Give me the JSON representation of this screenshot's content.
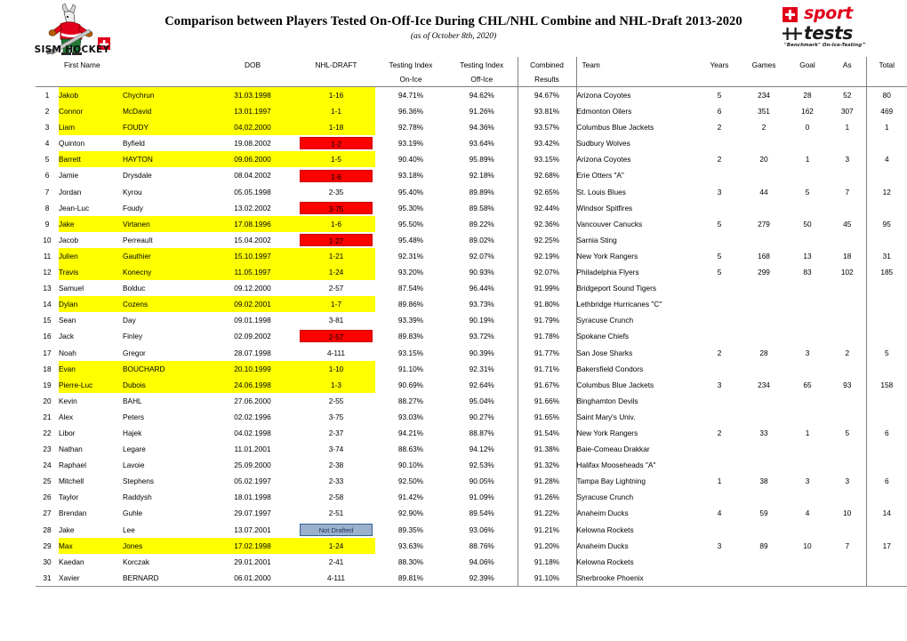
{
  "header": {
    "title": "Comparison between Players Tested On-Off-Ice During CHL/NHL Combine and NHL-Draft 2013-2020",
    "subtitle": "(as of October 8th, 2020)",
    "left_logo": {
      "wordmark": "SISM HOCKEY"
    },
    "right_logo": {
      "word_sport": "sport",
      "word_tests": "tests",
      "tagline": "\"Benchmark\" On-Ice-Testing™"
    }
  },
  "table": {
    "columns": {
      "index": "",
      "first_name": "First Name",
      "last_name": "",
      "dob": "DOB",
      "draft": "NHL-DRAFT",
      "testing_on_l1": "Testing Index",
      "testing_on_l2": "On-Ice",
      "testing_off_l1": "Testing Index",
      "testing_off_l2": "Off-Ice",
      "combined_l1": "Combined",
      "combined_l2": "Results",
      "team": "Team",
      "years": "Years",
      "games": "Games",
      "goal": "Goal",
      "as": "As",
      "total": "Total"
    },
    "rows": [
      {
        "n": "1",
        "first": "Jakob",
        "last": "Chychrun",
        "dob": "31.03.1998",
        "draft": "1-16",
        "draft_style": "plain",
        "on": "94.71%",
        "off": "94.62%",
        "comb": "94.67%",
        "team": "Arizona Coyotes",
        "years": "5",
        "games": "234",
        "goal": "28",
        "as": "52",
        "total": "80",
        "hl": true
      },
      {
        "n": "2",
        "first": "Connor",
        "last": "McDavid",
        "dob": "13.01.1997",
        "draft": "1-1",
        "draft_style": "plain",
        "on": "96.36%",
        "off": "91.26%",
        "comb": "93.81%",
        "team": "Edmonton Oilers",
        "years": "6",
        "games": "351",
        "goal": "162",
        "as": "307",
        "total": "469",
        "hl": true
      },
      {
        "n": "3",
        "first": "Liam",
        "last": "FOUDY",
        "dob": "04,02,2000",
        "draft": "1-18",
        "draft_style": "plain",
        "on": "92.78%",
        "off": "94.36%",
        "comb": "93.57%",
        "team": "Columbus Blue Jackets",
        "years": "2",
        "games": "2",
        "goal": "0",
        "as": "1",
        "total": "1",
        "hl": true
      },
      {
        "n": "4",
        "first": "Quinton",
        "last": "Byfield",
        "dob": "19.08.2002",
        "draft": "1-2",
        "draft_style": "red",
        "on": "93.19%",
        "off": "93.64%",
        "comb": "93.42%",
        "team": "Sudbury Wolves",
        "years": "",
        "games": "",
        "goal": "",
        "as": "",
        "total": "",
        "hl": false
      },
      {
        "n": "5",
        "first": "Barrett",
        "last": "HAYTON",
        "dob": "09.06.2000",
        "draft": "1-5",
        "draft_style": "plain",
        "on": "90.40%",
        "off": "95.89%",
        "comb": "93.15%",
        "team": "Arizona Coyotes",
        "years": "2",
        "games": "20",
        "goal": "1",
        "as": "3",
        "total": "4",
        "hl": true
      },
      {
        "n": "6",
        "first": "Jamie",
        "last": "Drysdale",
        "dob": "08.04.2002",
        "draft": "1-6",
        "draft_style": "red",
        "on": "93.18%",
        "off": "92.18%",
        "comb": "92.68%",
        "team": "Erie Otters \"A\"",
        "years": "",
        "games": "",
        "goal": "",
        "as": "",
        "total": "",
        "hl": false
      },
      {
        "n": "7",
        "first": "Jordan",
        "last": "Kyrou",
        "dob": "05.05.1998",
        "draft": "2-35",
        "draft_style": "plain",
        "on": "95.40%",
        "off": "89.89%",
        "comb": "92.65%",
        "team": "St. Louis Blues",
        "years": "3",
        "games": "44",
        "goal": "5",
        "as": "7",
        "total": "12",
        "hl": false
      },
      {
        "n": "8",
        "first": "Jean-Luc",
        "last": "Foudy",
        "dob": "13.02.2002",
        "draft": "3-75",
        "draft_style": "red",
        "on": "95.30%",
        "off": "89.58%",
        "comb": "92.44%",
        "team": "Windsor Spitfires",
        "years": "",
        "games": "",
        "goal": "",
        "as": "",
        "total": "",
        "hl": false
      },
      {
        "n": "9",
        "first": "Jake",
        "last": "Virtanen",
        "dob": "17.08.1996",
        "draft": "1-6",
        "draft_style": "plain",
        "on": "95.50%",
        "off": "89.22%",
        "comb": "92.36%",
        "team": "Vancouver Canucks",
        "years": "5",
        "games": "279",
        "goal": "50",
        "as": "45",
        "total": "95",
        "hl": true
      },
      {
        "n": "10",
        "first": "Jacob",
        "last": "Perreault",
        "dob": "15.04.2002",
        "draft": "1-27",
        "draft_style": "red",
        "on": "95.48%",
        "off": "89.02%",
        "comb": "92.25%",
        "team": "Sarnia Sting",
        "years": "",
        "games": "",
        "goal": "",
        "as": "",
        "total": "",
        "hl": false
      },
      {
        "n": "11",
        "first": "Julien",
        "last": "Gauthier",
        "dob": "15.10.1997",
        "draft": "1-21",
        "draft_style": "plain",
        "on": "92.31%",
        "off": "92.07%",
        "comb": "92.19%",
        "team": "New York Rangers",
        "years": "5",
        "games": "168",
        "goal": "13",
        "as": "18",
        "total": "31",
        "hl": true
      },
      {
        "n": "12",
        "first": "Travis",
        "last": "Konecny",
        "dob": "11.05.1997",
        "draft": "1-24",
        "draft_style": "plain",
        "on": "93.20%",
        "off": "90.93%",
        "comb": "92.07%",
        "team": "Philadelphia Flyers",
        "years": "5",
        "games": "299",
        "goal": "83",
        "as": "102",
        "total": "185",
        "hl": true
      },
      {
        "n": "13",
        "first": "Samuel",
        "last": "Bolduc",
        "dob": "09.12.2000",
        "draft": "2-57",
        "draft_style": "plain",
        "on": "87.54%",
        "off": "96.44%",
        "comb": "91.99%",
        "team": "Bridgeport Sound Tigers",
        "years": "",
        "games": "",
        "goal": "",
        "as": "",
        "total": "",
        "hl": false
      },
      {
        "n": "14",
        "first": "Dylan",
        "last": "Cozens",
        "dob": "09.02.2001",
        "draft": "1-7",
        "draft_style": "plain",
        "on": "89.86%",
        "off": "93.73%",
        "comb": "91.80%",
        "team": "Lethbridge Hurricanes \"C\"",
        "years": "",
        "games": "",
        "goal": "",
        "as": "",
        "total": "",
        "hl": true
      },
      {
        "n": "15",
        "first": "Sean",
        "last": "Day",
        "dob": "09.01.1998",
        "draft": "3-81",
        "draft_style": "plain",
        "on": "93.39%",
        "off": "90.19%",
        "comb": "91.79%",
        "team": "Syracuse Crunch",
        "years": "",
        "games": "",
        "goal": "",
        "as": "",
        "total": "",
        "hl": false
      },
      {
        "n": "16",
        "first": "Jack",
        "last": "Finley",
        "dob": "02.09.2002",
        "draft": "2-57",
        "draft_style": "red",
        "on": "89.83%",
        "off": "93.72%",
        "comb": "91.78%",
        "team": "Spokane Chiefs",
        "years": "",
        "games": "",
        "goal": "",
        "as": "",
        "total": "",
        "hl": false
      },
      {
        "n": "17",
        "first": "Noah",
        "last": "Gregor",
        "dob": "28.07.1998",
        "draft": "4-111",
        "draft_style": "plain",
        "on": "93.15%",
        "off": "90.39%",
        "comb": "91.77%",
        "team": "San Jose Sharks",
        "years": "2",
        "games": "28",
        "goal": "3",
        "as": "2",
        "total": "5",
        "hl": false
      },
      {
        "n": "18",
        "first": "Evan",
        "last": "BOUCHARD",
        "dob": "20.10.1999",
        "draft": "1-10",
        "draft_style": "plain",
        "on": "91.10%",
        "off": "92.31%",
        "comb": "91.71%",
        "team": "Bakersfield Condors",
        "years": "",
        "games": "",
        "goal": "",
        "as": "",
        "total": "",
        "hl": true
      },
      {
        "n": "19",
        "first": "Pierre-Luc",
        "last": "Dubois",
        "dob": "24.06.1998",
        "draft": "1-3",
        "draft_style": "plain",
        "on": "90.69%",
        "off": "92.64%",
        "comb": "91.67%",
        "team": "Columbus Blue Jackets",
        "years": "3",
        "games": "234",
        "goal": "65",
        "as": "93",
        "total": "158",
        "hl": true
      },
      {
        "n": "20",
        "first": "Kevin",
        "last": "BAHL",
        "dob": "27.06.2000",
        "draft": "2-55",
        "draft_style": "plain",
        "on": "88.27%",
        "off": "95.04%",
        "comb": "91.66%",
        "team": "Binghamton Devils",
        "years": "",
        "games": "",
        "goal": "",
        "as": "",
        "total": "",
        "hl": false
      },
      {
        "n": "21",
        "first": "Alex",
        "last": "Peters",
        "dob": "02.02.1996",
        "draft": "3-75",
        "draft_style": "plain",
        "on": "93.03%",
        "off": "90.27%",
        "comb": "91.65%",
        "team": "Saint Mary's Univ.",
        "years": "",
        "games": "",
        "goal": "",
        "as": "",
        "total": "",
        "hl": false
      },
      {
        "n": "22",
        "first": "Libor",
        "last": "Hajek",
        "dob": "04.02.1998",
        "draft": "2-37",
        "draft_style": "plain",
        "on": "94.21%",
        "off": "88.87%",
        "comb": "91.54%",
        "team": "New York Rangers",
        "years": "2",
        "games": "33",
        "goal": "1",
        "as": "5",
        "total": "6",
        "hl": false
      },
      {
        "n": "23",
        "first": "Nathan",
        "last": "Legare",
        "dob": "11.01.2001",
        "draft": "3-74",
        "draft_style": "plain",
        "on": "88.63%",
        "off": "94.12%",
        "comb": "91.38%",
        "team": "Baie-Comeau Drakkar",
        "years": "",
        "games": "",
        "goal": "",
        "as": "",
        "total": "",
        "hl": false
      },
      {
        "n": "24",
        "first": "Raphael",
        "last": "Lavoie",
        "dob": "25.09.2000",
        "draft": "2-38",
        "draft_style": "plain",
        "on": "90.10%",
        "off": "92.53%",
        "comb": "91.32%",
        "team": "Halifax Mooseheads \"A\"",
        "years": "",
        "games": "",
        "goal": "",
        "as": "",
        "total": "",
        "hl": false
      },
      {
        "n": "25",
        "first": "Mitchell",
        "last": "Stephens",
        "dob": "05.02.1997",
        "draft": "2-33",
        "draft_style": "plain",
        "on": "92.50%",
        "off": "90.05%",
        "comb": "91.28%",
        "team": "Tampa Bay Lightning",
        "years": "1",
        "games": "38",
        "goal": "3",
        "as": "3",
        "total": "6",
        "hl": false
      },
      {
        "n": "26",
        "first": "Taylor",
        "last": "Raddysh",
        "dob": "18.01.1998",
        "draft": "2-58",
        "draft_style": "plain",
        "on": "91.42%",
        "off": "91.09%",
        "comb": "91.26%",
        "team": "Syracuse Crunch",
        "years": "",
        "games": "",
        "goal": "",
        "as": "",
        "total": "",
        "hl": false
      },
      {
        "n": "27",
        "first": "Brendan",
        "last": "Guhle",
        "dob": "29.07.1997",
        "draft": "2-51",
        "draft_style": "plain",
        "on": "92.90%",
        "off": "89.54%",
        "comb": "91.22%",
        "team": "Anaheim Ducks",
        "years": "4",
        "games": "59",
        "goal": "4",
        "as": "10",
        "total": "14",
        "hl": false
      },
      {
        "n": "28",
        "first": "Jake",
        "last": "Lee",
        "dob": "13.07.2001",
        "draft": "Not Drafted",
        "draft_style": "blue",
        "on": "89.35%",
        "off": "93.06%",
        "comb": "91.21%",
        "team": "Kelowna Rockets",
        "years": "",
        "games": "",
        "goal": "",
        "as": "",
        "total": "",
        "hl": false
      },
      {
        "n": "29",
        "first": "Max",
        "last": "Jones",
        "dob": "17.02.1998",
        "draft": "1-24",
        "draft_style": "plain",
        "on": "93.63%",
        "off": "88.76%",
        "comb": "91.20%",
        "team": "Anaheim Ducks",
        "years": "3",
        "games": "89",
        "goal": "10",
        "as": "7",
        "total": "17",
        "hl": true
      },
      {
        "n": "30",
        "first": "Kaedan",
        "last": "Korczak",
        "dob": "29.01.2001",
        "draft": "2-41",
        "draft_style": "plain",
        "on": "88.30%",
        "off": "94.06%",
        "comb": "91.18%",
        "team": "Kelowna Rockets",
        "years": "",
        "games": "",
        "goal": "",
        "as": "",
        "total": "",
        "hl": false
      },
      {
        "n": "31",
        "first": "Xavier",
        "last": "BERNARD",
        "dob": "06.01.2000",
        "draft": "4-111",
        "draft_style": "plain",
        "on": "89.81%",
        "off": "92.39%",
        "comb": "91.10%",
        "team": "Sherbrooke Phoenix",
        "years": "",
        "games": "",
        "goal": "",
        "as": "",
        "total": "",
        "hl": false
      }
    ]
  },
  "colors": {
    "highlight_yellow": "#ffff00",
    "chip_red": "#ff0000",
    "chip_blue": "#9ab0cc",
    "brand_red": "#e2001a"
  }
}
